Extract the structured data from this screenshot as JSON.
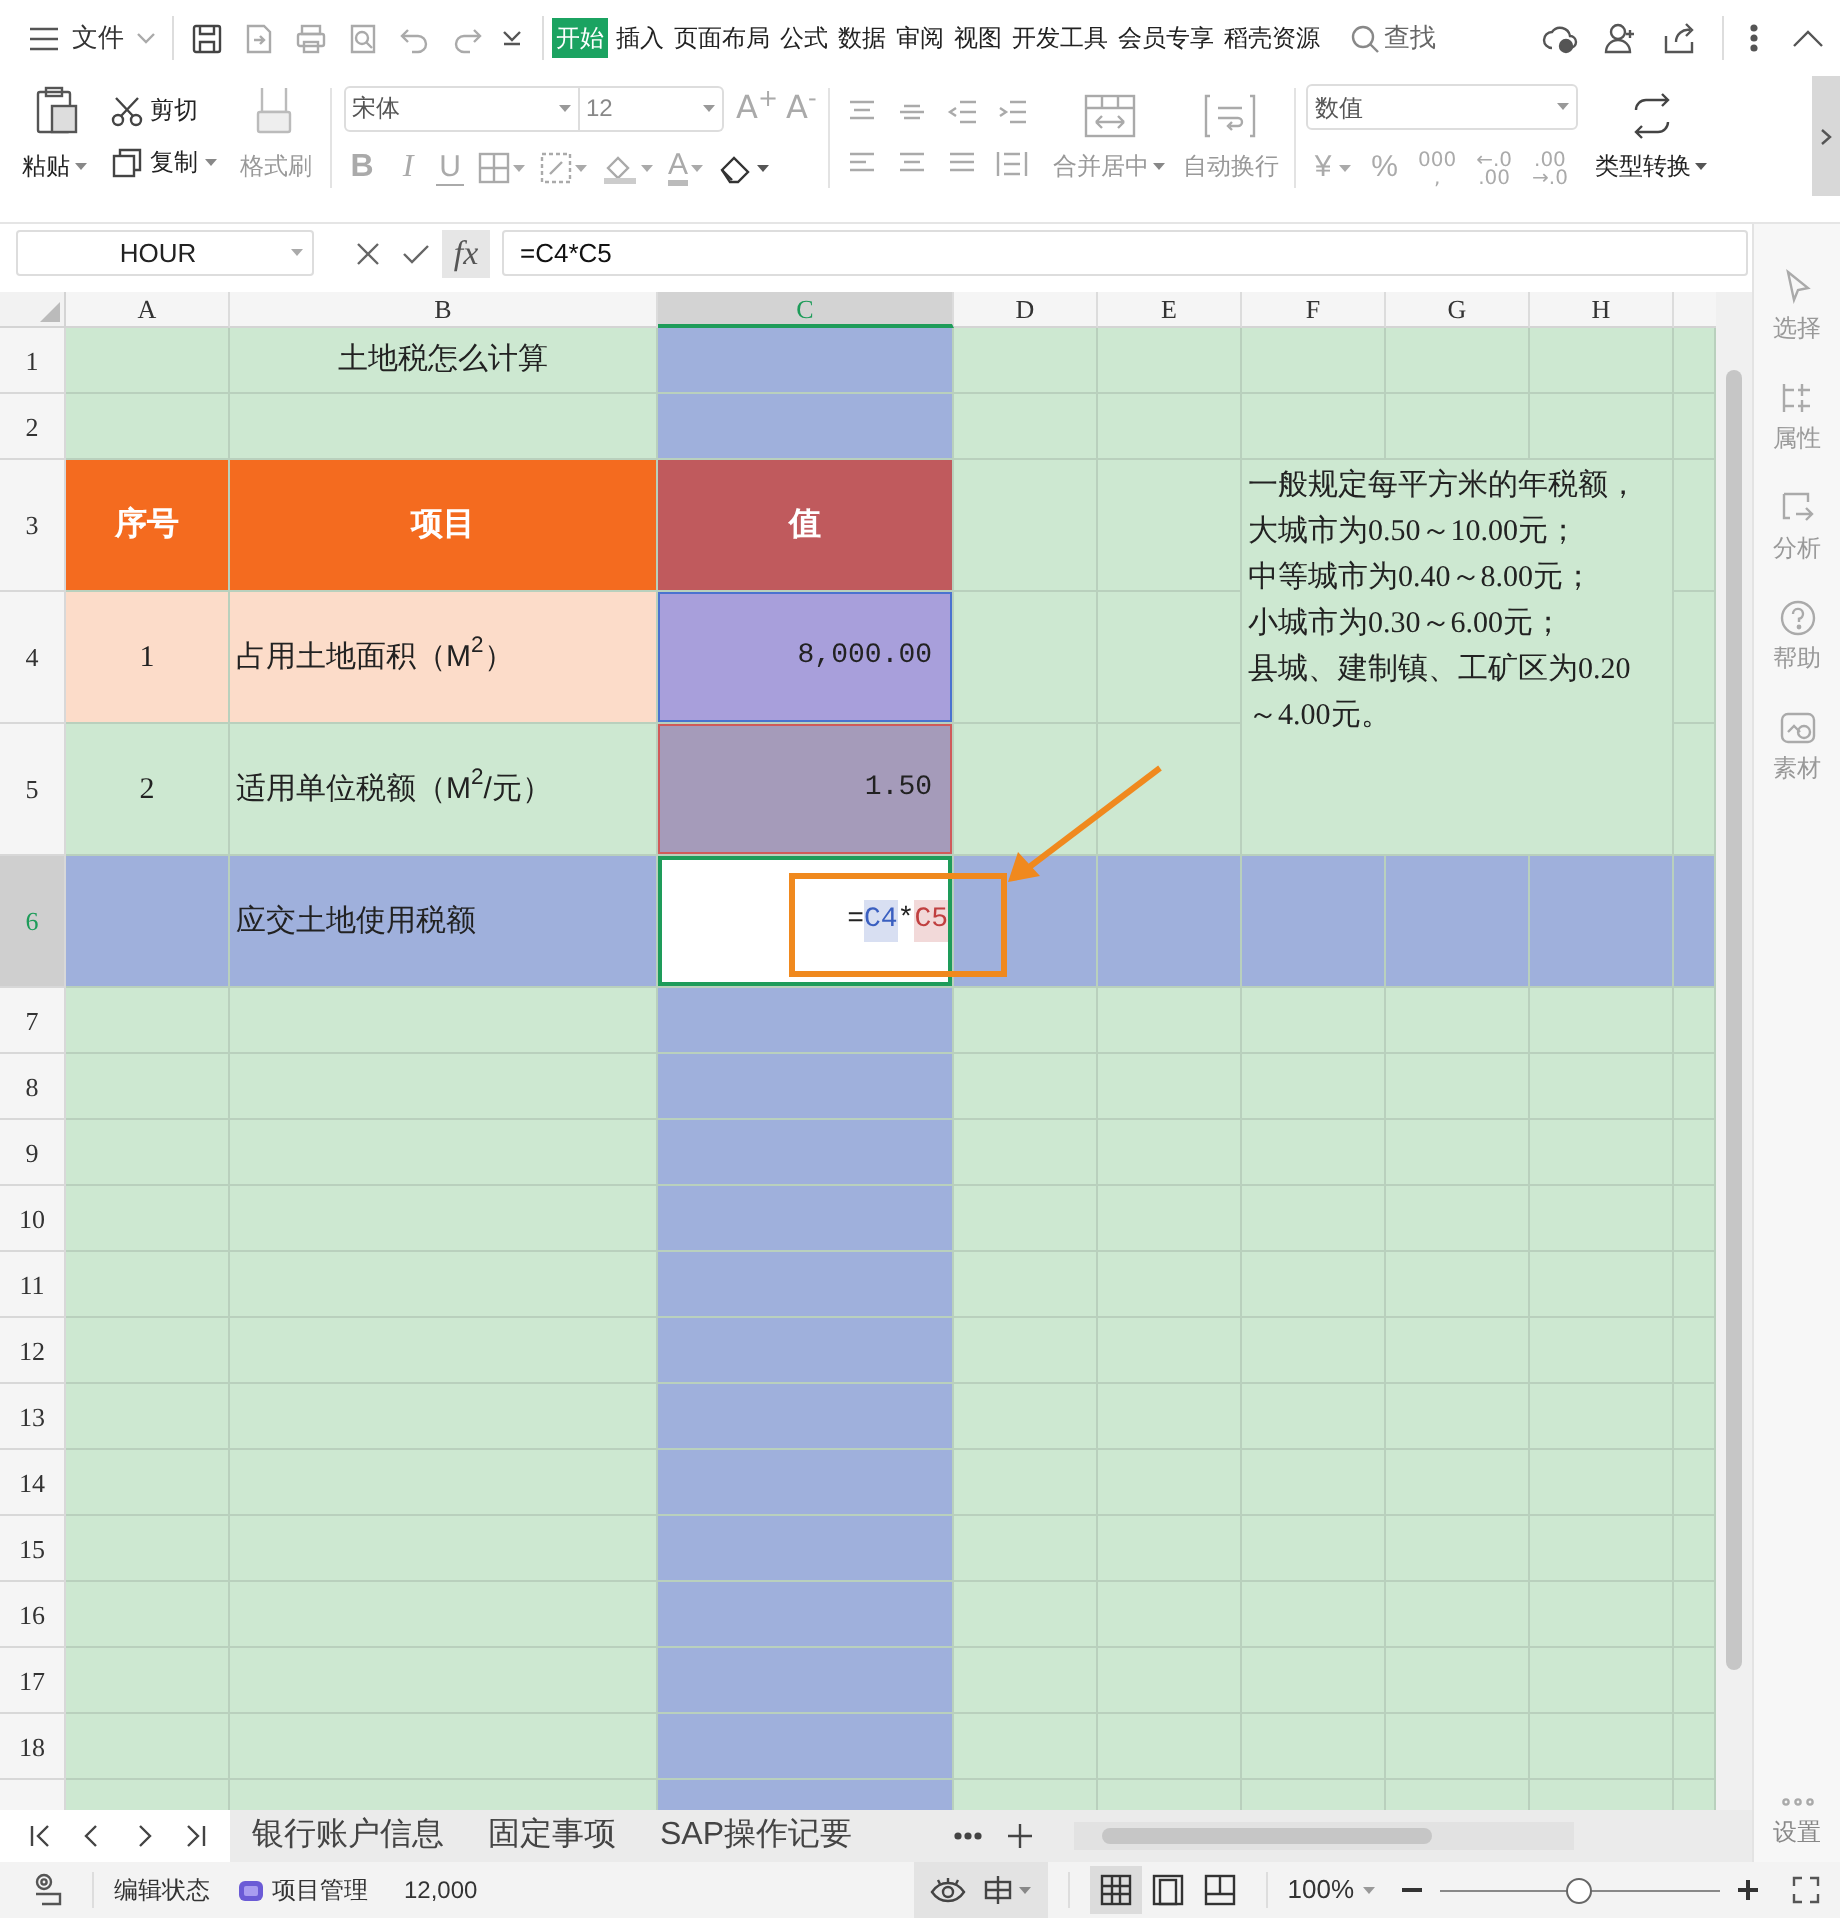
{
  "title_bar": {
    "file_menu": "文件",
    "tabs": [
      {
        "label": "开始",
        "selected": true
      },
      {
        "label": "插入",
        "selected": false
      },
      {
        "label": "页面布局",
        "selected": false
      },
      {
        "label": "公式",
        "selected": false
      },
      {
        "label": "数据",
        "selected": false
      },
      {
        "label": "审阅",
        "selected": false
      },
      {
        "label": "视图",
        "selected": false
      },
      {
        "label": "开发工具",
        "selected": false
      },
      {
        "label": "会员专享",
        "selected": false
      },
      {
        "label": "稻壳资源",
        "selected": false
      }
    ],
    "search": "查找"
  },
  "ribbon": {
    "clipboard": [
      {
        "label": "粘贴",
        "kind": "large",
        "dropdown": true,
        "disabled": false
      },
      {
        "label": "剪切",
        "kind": "small",
        "dropdown": false,
        "disabled": false
      },
      {
        "label": "复制",
        "kind": "small",
        "dropdown": true,
        "disabled": false
      },
      {
        "label": "格式刷",
        "kind": "large",
        "dropdown": false,
        "disabled": true
      }
    ],
    "font": {
      "name": "宋体",
      "size": "12",
      "grow": "A$^{+}$",
      "shrink": "A$^{-}$",
      "bold": "B",
      "italic": "I",
      "underline": "U",
      "font_color": "A"
    },
    "alignment": [
      {
        "label": "合并居中",
        "dropdown": true,
        "disabled": true
      },
      {
        "label": "自动换行",
        "dropdown": false,
        "disabled": true
      }
    ],
    "number": {
      "format": "数值",
      "currency": "¥",
      "percent": "%",
      "thousands": [
        "000",
        ","
      ],
      "add_decimal": [
        "←.0",
        ".00"
      ],
      "remove_decimal": [
        ".00",
        "→.0"
      ]
    },
    "convert": {
      "label": "类型转换",
      "dropdown": true,
      "disabled": false
    }
  },
  "formula_bar": {
    "name_box": "HOUR",
    "fx": "fx",
    "formula": "=C4*C5"
  },
  "sheet": {
    "columns": [
      {
        "label": "A",
        "selected": false
      },
      {
        "label": "B",
        "selected": false
      },
      {
        "label": "C",
        "selected": true
      },
      {
        "label": "D",
        "selected": false
      },
      {
        "label": "E",
        "selected": false
      },
      {
        "label": "F",
        "selected": false
      },
      {
        "label": "G",
        "selected": false
      },
      {
        "label": "H",
        "selected": false
      }
    ],
    "rows": [
      {
        "label": "1",
        "selected": false,
        "cells": [
          {},
          {
            "kind": "title",
            "text": "土地税怎么计算"
          }
        ]
      },
      {
        "label": "2",
        "selected": false
      },
      {
        "label": "3",
        "selected": false,
        "cells": [
          {
            "kind": "header",
            "text": "序号",
            "color": "#f46b1f"
          },
          {
            "kind": "header",
            "text": "项目",
            "color": "#f46b1f"
          },
          {
            "kind": "header",
            "text": "值",
            "color": "#c05a5d"
          }
        ]
      },
      {
        "label": "4",
        "selected": false,
        "cells": [
          {
            "kind": "index",
            "text": "1",
            "color": "#fcdcc9"
          },
          {
            "kind": "label",
            "text": "占用土地面积（M$^{2}$）",
            "color": "#fcdcc9"
          },
          {
            "kind": "number",
            "text": "8,000.00",
            "color": "#a89fdb",
            "outline": {
              "color": "#4a72d0"
            }
          }
        ]
      },
      {
        "label": "5",
        "selected": false,
        "cells": [
          {
            "kind": "index",
            "text": "2"
          },
          {
            "kind": "label",
            "text": "适用单位税额（M$^{2}$/元）"
          },
          {
            "kind": "number",
            "text": "1.50",
            "color": "#a59bba",
            "outline": {
              "color": "#d05a5a"
            }
          }
        ]
      },
      {
        "label": "6",
        "selected": true,
        "cells": [
          {},
          {
            "kind": "label",
            "text": "应交土地使用税额"
          },
          {
            "kind": "formula",
            "editing": true,
            "parts": [
              {
                "text": "="
              },
              {
                "text": "C4",
                "color": "#3a5fc0"
              },
              {
                "text": "*"
              },
              {
                "text": "C5",
                "color": "#c04040"
              }
            ]
          }
        ]
      },
      {
        "label": "7",
        "selected": false
      },
      {
        "label": "8",
        "selected": false
      },
      {
        "label": "9",
        "selected": false
      },
      {
        "label": "10",
        "selected": false
      },
      {
        "label": "11",
        "selected": false
      },
      {
        "label": "12",
        "selected": false
      },
      {
        "label": "13",
        "selected": false
      },
      {
        "label": "14",
        "selected": false
      },
      {
        "label": "15",
        "selected": false
      },
      {
        "label": "16",
        "selected": false
      },
      {
        "label": "17",
        "selected": false
      },
      {
        "label": "18",
        "selected": false
      },
      {
        "selected": false
      }
    ],
    "note_lines": [
      "一般规定每平方米的年税额，",
      "大城市为0.50～10.00元；",
      "中等城市为0.40～8.00元；",
      "小城市为0.30～6.00元；",
      "县城、建制镇、工矿区为0.20",
      "～4.00元。"
    ]
  },
  "side_panel": {
    "items": [
      {
        "label": "选择"
      },
      {
        "label": "属性"
      },
      {
        "label": "分析"
      },
      {
        "label": "帮助"
      },
      {
        "label": "素材"
      }
    ],
    "settings": "设置"
  },
  "sheet_tabs": [
    {
      "label": "银行账户信息",
      "selected": false
    },
    {
      "label": "固定事项",
      "selected": false
    },
    {
      "label": "SAP操作记要",
      "selected": false
    }
  ],
  "status_bar": {
    "mode": "编辑状态",
    "app": "项目管理",
    "value": "12,000",
    "views": [
      {
        "selected": true
      },
      {
        "selected": false
      },
      {
        "selected": false
      }
    ],
    "zoom": "100%",
    "zoom_slider": {
      "level": 0.49
    }
  }
}
